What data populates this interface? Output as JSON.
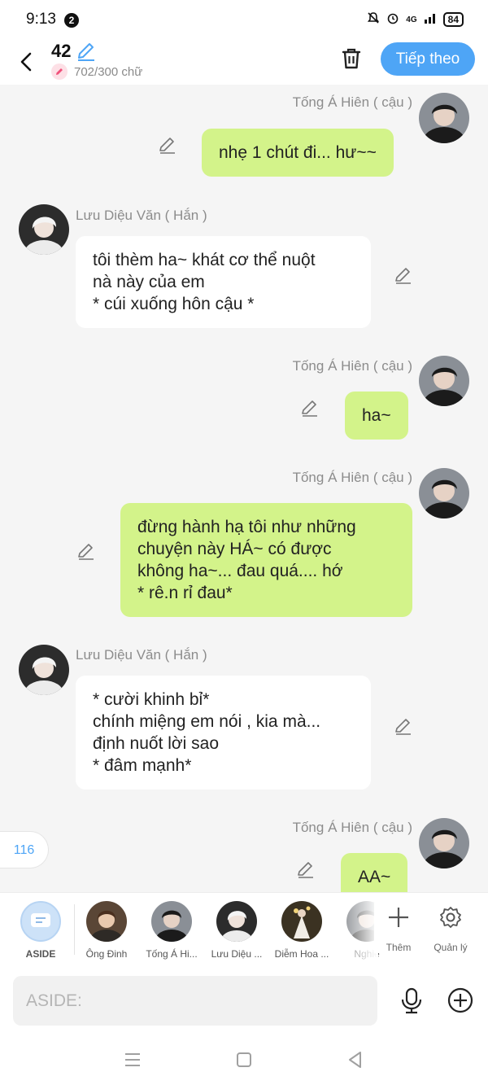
{
  "status": {
    "time": "9:13",
    "notif_count": "2",
    "network": "4G",
    "battery": "84"
  },
  "header": {
    "count": "42",
    "char_count": "702/300 chữ",
    "next_label": "Tiếp theo"
  },
  "messages": [
    {
      "side": "right",
      "name": "Tống Á Hiên ( cậu )",
      "text": "nhẹ 1 chút đi...  hư~~"
    },
    {
      "side": "left",
      "name": "Lưu Diệu Văn ( Hắn )",
      "text": "tôi thèm ha~ khát cơ thể nuột\nnà này của em\n* cúi xuống hôn cậu *"
    },
    {
      "side": "right",
      "name": "Tống Á Hiên ( cậu )",
      "text": "ha~"
    },
    {
      "side": "right",
      "name": "Tống Á Hiên ( cậu )",
      "text": "đừng hành hạ tôi như những\nchuyện này HÁ~ có được\nkhông ha~... đau quá.... hớ\n* rê.n rỉ đau*"
    },
    {
      "side": "left",
      "name": "Lưu Diệu Văn ( Hắn )",
      "text": "* cười khinh bỉ*\nchính miệng em nói , kia mà...\nđịnh nuốt lời sao\n* đâm mạnh*"
    },
    {
      "side": "right",
      "name": "Tống Á Hiên ( cậu )",
      "text": "AA~"
    }
  ],
  "counter": "116",
  "characters": [
    {
      "label": "ASIDE"
    },
    {
      "label": "Ông Đinh"
    },
    {
      "label": "Tống Á Hi..."
    },
    {
      "label": "Lưu Diệu ..."
    },
    {
      "label": "Diễm Hoa ..."
    },
    {
      "label": "Nghiê"
    }
  ],
  "tools": {
    "add_label": "Thêm",
    "manage_label": "Quản lý"
  },
  "input": {
    "placeholder": "ASIDE:"
  },
  "colors": {
    "accent": "#4ea5f6",
    "outgoing_bubble": "#d3f38a",
    "incoming_bubble": "#ffffff",
    "background": "#f5f5f5"
  }
}
